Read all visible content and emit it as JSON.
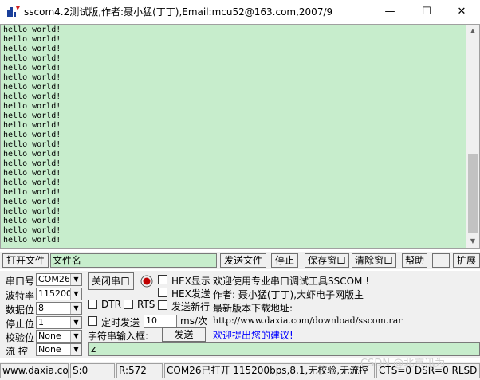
{
  "window": {
    "title": "sscom4.2测试版,作者:聂小猛(丁丁),Email:mcu52@163.com,2007/9",
    "minimize_glyph": "—",
    "maximize_glyph": "☐",
    "close_glyph": "✕"
  },
  "receive": {
    "lines": [
      "hello world!",
      "hello world!",
      "hello world!",
      "hello world!",
      "hello world!",
      "hello world!",
      "hello world!",
      "hello world!",
      "hello world!",
      "hello world!",
      "hello world!",
      "hello world!",
      "hello world!",
      "hello world!",
      "hello world!",
      "hello world!",
      "hello world!",
      "hello world!",
      "hello world!",
      "hello world!",
      "hello world!",
      "hello world!",
      "hello world!"
    ]
  },
  "toolbar": {
    "open_file": "打开文件",
    "file_name": "文件名",
    "send_file": "发送文件",
    "stop": "停止",
    "save_window": "保存窗口",
    "clear_window": "清除窗口",
    "help": "帮助",
    "minus": "-",
    "expand": "扩展"
  },
  "settings": {
    "port_label": "串口号",
    "port_value": "COM26",
    "baud_label": "波特率",
    "baud_value": "115200",
    "databits_label": "数据位",
    "databits_value": "8",
    "stopbits_label": "停止位",
    "stopbits_value": "1",
    "parity_label": "校验位",
    "parity_value": "None",
    "flow_label": "流 控",
    "flow_value": "None"
  },
  "controls": {
    "close_port": "关闭串口",
    "hex_display": "HEX显示",
    "hex_send": "HEX发送",
    "dtr": "DTR",
    "rts": "RTS",
    "send_newline": "发送新行",
    "timed_send": "定时发送",
    "interval_value": "10",
    "interval_unit": "ms/次",
    "string_input_label": "字符串输入框:",
    "send_button": "发送",
    "send_text": "z"
  },
  "welcome": {
    "line1": "欢迎使用专业串口调试工具SSCOM !",
    "line2": "作者: 聂小猛(丁丁),大虾电子网版主",
    "line3": "最新版本下载地址:",
    "line4": "http://www.daxia.com/download/sscom.rar",
    "line5": "欢迎提出您的建议!"
  },
  "status": {
    "site": "www.daxia.com",
    "sent": "S:0",
    "received": "R:572",
    "port_info": "COM26已打开  115200bps,8,1,无校验,无流控",
    "signals": "CTS=0 DSR=0 RLSD"
  },
  "watermark": "CSDN @北京迅为",
  "colors": {
    "green_bg": "#c7edcc",
    "indicator_red": "#c00000",
    "link_blue": "#0000ff"
  }
}
